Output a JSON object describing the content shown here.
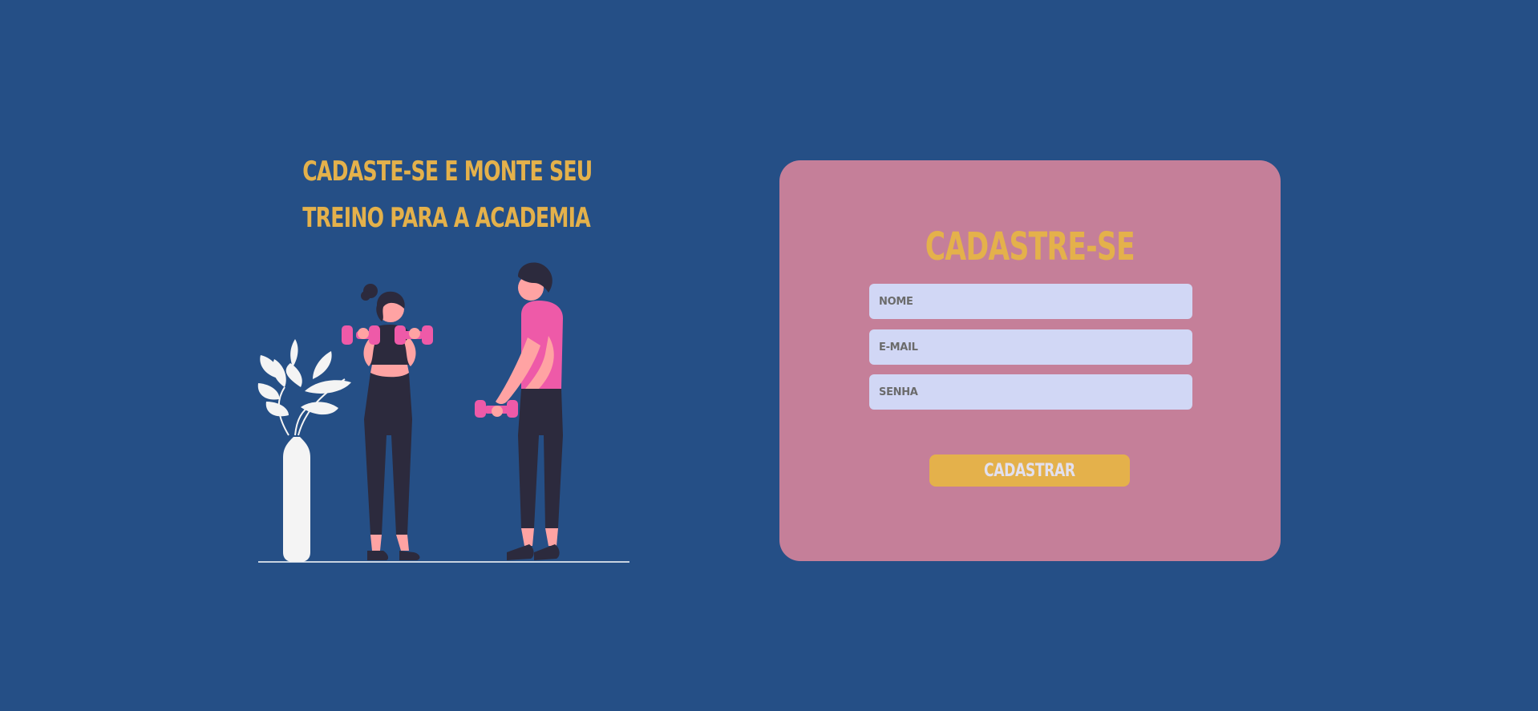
{
  "hero": {
    "headline_line1": "CADASTE-SE E MONTE SEU",
    "headline_line2": "TREINO PARA A ACADEMIA"
  },
  "form": {
    "title": "CADASTRE-SE",
    "fields": [
      {
        "placeholder": "NOME",
        "value": ""
      },
      {
        "placeholder": "E-MAIL",
        "value": ""
      },
      {
        "placeholder": "SENHA",
        "value": ""
      }
    ],
    "submit_label": "CADASTRAR"
  },
  "colors": {
    "background": "#254f86",
    "accent": "#e4b14b",
    "card": "#c57f99",
    "input": "#d1d7f5",
    "figure_pink": "#ee5aa8",
    "figure_dark": "#2c2a3d"
  },
  "illustration": {
    "icon": "gym-workout-illustration"
  }
}
